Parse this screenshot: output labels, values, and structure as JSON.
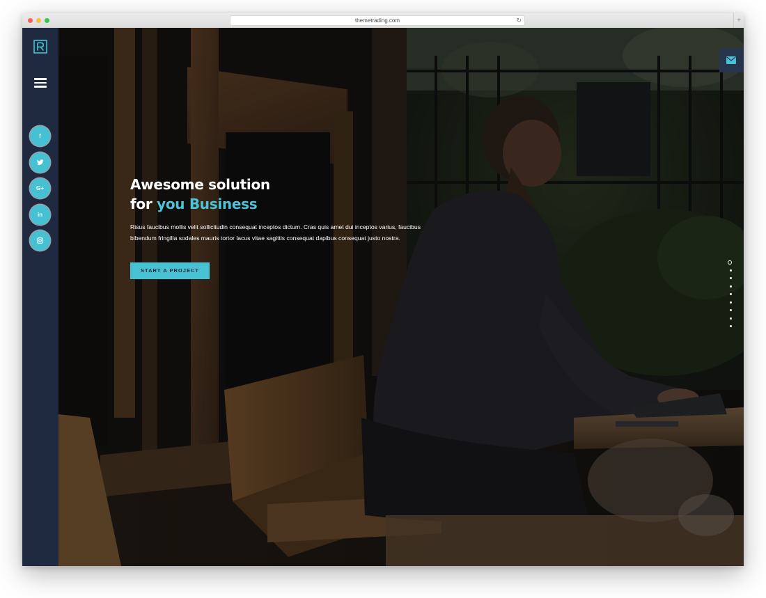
{
  "browser": {
    "url": "themetrading.com",
    "reload_glyph": "↻",
    "new_tab_glyph": "+"
  },
  "sidebar": {
    "logo_letter": "R",
    "menu_icon": "hamburger-icon",
    "social": [
      {
        "name": "facebook",
        "glyph": "f"
      },
      {
        "name": "twitter",
        "glyph": "t"
      },
      {
        "name": "google-plus",
        "glyph": "G+"
      },
      {
        "name": "linkedin",
        "glyph": "in"
      },
      {
        "name": "instagram",
        "glyph": "◎"
      }
    ]
  },
  "hero": {
    "title_line1": "Awesome solution",
    "title_line2_prefix": "for",
    "title_line2_accent": "you Business",
    "body": "Risus faucibus mollis velit sollicitudin consequat inceptos dictum. Cras quis amet dui inceptos varius, faucibus bibendum fringilla sodales mauris tortor lacus vitae sagittis consequat dapibus consequat justo nostra.",
    "cta_label": "START A PROJECT",
    "contact_icon": "envelope-icon",
    "section_dots": {
      "count": 9,
      "active_index": 0
    },
    "slides": {
      "count": 3,
      "active_index": 0
    }
  },
  "colors": {
    "accent": "#46c2d4",
    "sidebar": "#1f2a40",
    "contact_button": "#26344c",
    "text": "#ffffff"
  }
}
